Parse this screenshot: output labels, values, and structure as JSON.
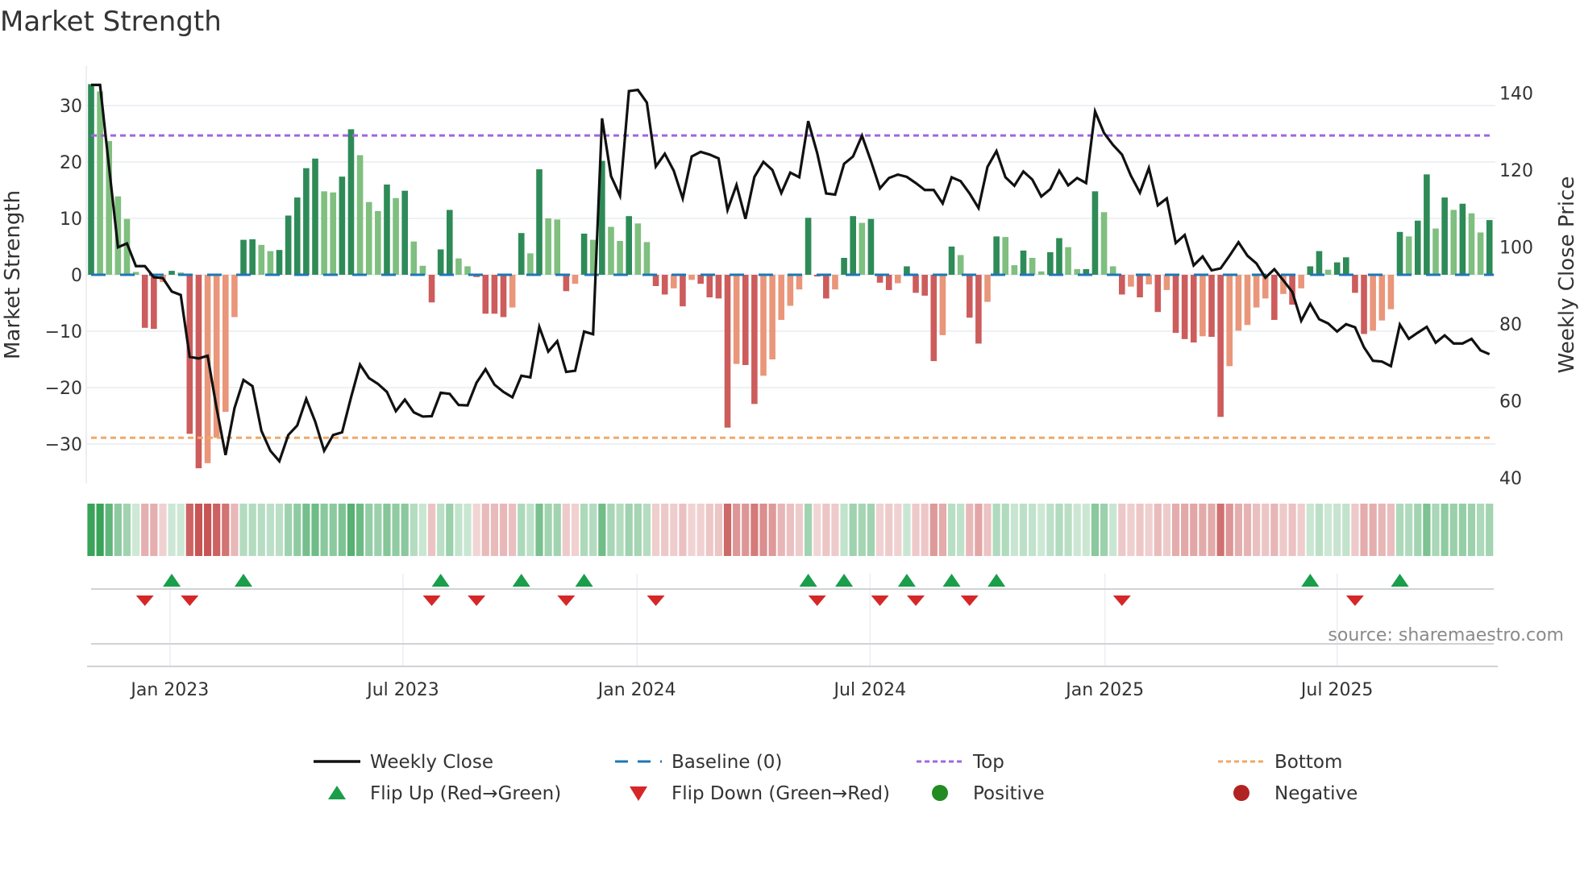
{
  "chart_data": {
    "type": "bar",
    "title": "Market Strength",
    "ylabel": "Market Strength",
    "y2label": "Weekly Close Price",
    "ylim": [
      -37,
      37
    ],
    "y2lim": [
      38.5,
      147
    ],
    "yticks": [
      -30,
      -20,
      -10,
      0,
      10,
      20,
      30
    ],
    "y2ticks": [
      40,
      60,
      80,
      100,
      120,
      140
    ],
    "top_level": 24.7,
    "bottom_level": -28.9,
    "grid": true,
    "legend_placement": "bottom",
    "xticks": [
      {
        "label": "Jan 2023",
        "week_index": 8.8
      },
      {
        "label": "Jul 2023",
        "week_index": 34.8
      },
      {
        "label": "Jan 2024",
        "week_index": 60.9
      },
      {
        "label": "Jul 2024",
        "week_index": 86.9
      },
      {
        "label": "Jan 2025",
        "week_index": 113.1
      },
      {
        "label": "Jul 2025",
        "week_index": 139.0
      }
    ],
    "series": [
      {
        "name": "Market Strength",
        "type": "bar",
        "values": [
          33.8,
          32.5,
          23.7,
          13.9,
          9.9,
          0.5,
          -9.4,
          -9.6,
          -1.3,
          0.7,
          0.4,
          -28.2,
          -34.3,
          -33.4,
          -28.9,
          -24.3,
          -7.5,
          6.2,
          6.3,
          5.3,
          4.2,
          4.4,
          10.5,
          13.7,
          18.9,
          20.6,
          14.8,
          14.6,
          17.4,
          25.8,
          21.2,
          12.9,
          11.3,
          16,
          13.6,
          14.9,
          5.9,
          1.6,
          -4.9,
          4.5,
          11.5,
          2.9,
          1.5,
          -0.4,
          -6.9,
          -6.9,
          -7.5,
          -5.8,
          7.4,
          3.8,
          18.7,
          10,
          9.8,
          -2.9,
          -1.6,
          7.3,
          6.2,
          20.2,
          8.5,
          6,
          10.4,
          9.1,
          5.8,
          -2,
          -3.5,
          -2.4,
          -5.6,
          -0.9,
          -1.6,
          -4,
          -4.2,
          -27.1,
          -15.8,
          -16,
          -22.9,
          -17.9,
          -15,
          -8,
          -5.5,
          -2.6,
          10.1,
          -0.3,
          -4.2,
          -2.6,
          3,
          10.4,
          9.2,
          9.9,
          -1.4,
          -2.7,
          -1.5,
          1.5,
          -3.2,
          -3.7,
          -15.3,
          -10.7,
          5,
          3.5,
          -7.6,
          -12.2,
          -4.8,
          6.8,
          6.7,
          1.7,
          4.3,
          3,
          0.6,
          4,
          6.5,
          4.9,
          1,
          1,
          14.8,
          11.1,
          1.5,
          -3.5,
          -2.1,
          -4,
          -1.7,
          -6.6,
          -2.7,
          -10.3,
          -11.4,
          -12,
          -10.9,
          -11,
          -25.2,
          -16.2,
          -9.9,
          -8.9,
          -5.8,
          -4.2,
          -8,
          -3.4,
          -5.3,
          -2.4,
          1.5,
          4.2,
          0.9,
          2.2,
          3.1,
          -3.2,
          -10.5,
          -9.9,
          -8.1,
          -6.1,
          7.6,
          6.8,
          9.6,
          17.8,
          8.2,
          13.7,
          11.5,
          12.6,
          10.9,
          7.5,
          9.7
        ]
      },
      {
        "name": "Weekly Close",
        "type": "line",
        "axis": "right",
        "values": [
          142.1,
          142.1,
          120.8,
          99.9,
          100.9,
          95.0,
          95.0,
          92.1,
          91.9,
          88.4,
          87.5,
          71.4,
          71.0,
          71.7,
          58.1,
          45.9,
          58.1,
          65.4,
          63.8,
          52.2,
          47.0,
          44.3,
          51.1,
          53.6,
          60.5,
          54.6,
          47.0,
          51.1,
          51.8,
          60.9,
          69.4,
          65.9,
          64.4,
          62.3,
          57.3,
          60.3,
          57.0,
          55.9,
          56.0,
          62.1,
          61.8,
          58.9,
          58.8,
          64.7,
          68.2,
          64.2,
          62.3,
          60.9,
          66.5,
          66.1,
          79.2,
          72.8,
          75.5,
          67.5,
          67.8,
          78.0,
          77.3,
          133.4,
          118.4,
          113.3,
          140.5,
          140.8,
          137.5,
          120.9,
          124.2,
          119.8,
          112.6,
          123.5,
          124.7,
          124.0,
          123.0,
          109.6,
          116.1,
          107.3,
          118.2,
          122.1,
          120.0,
          114.0,
          119.3,
          118.1,
          132.7,
          124.4,
          113.9,
          113.6,
          121.6,
          123.5,
          128.9,
          122.3,
          115.2,
          117.9,
          118.8,
          118.2,
          116.6,
          114.8,
          114.8,
          111.3,
          118.1,
          117.1,
          113.9,
          110.1,
          120.8,
          124.9,
          118.1,
          115.9,
          119.6,
          117.5,
          113.1,
          115.0,
          119.8,
          116.0,
          117.9,
          116.6,
          135.2,
          129.6,
          126.5,
          124.0,
          118.5,
          114.1,
          120.5,
          110.8,
          112.6,
          101.0,
          103.1,
          95.2,
          97.5,
          93.9,
          94.4,
          97.7,
          101.2,
          97.7,
          95.7,
          92.0,
          94.2,
          91.3,
          88.3,
          80.8,
          85.2,
          81.2,
          80.1,
          78.0,
          79.9,
          79.1,
          73.9,
          70.4,
          70.2,
          69.0,
          79.8,
          76.1,
          77.7,
          79.2,
          75.1,
          77.0,
          74.9,
          74.9,
          76.1,
          73.1,
          72.1
        ]
      }
    ],
    "legend": [
      {
        "label": "Weekly Close",
        "marker": "line",
        "color": "#111111"
      },
      {
        "label": "Baseline (0)",
        "marker": "dashed-line",
        "color": "#1f77b4"
      },
      {
        "label": "Top",
        "marker": "dotted-line",
        "color": "#a066e0"
      },
      {
        "label": "Bottom",
        "marker": "dotted-line",
        "color": "#f0a868"
      },
      {
        "label": "Flip Up (Red→Green)",
        "marker": "triangle-up",
        "color": "#1a9e4a"
      },
      {
        "label": "Flip Down (Green→Red)",
        "marker": "triangle-down",
        "color": "#d62728"
      },
      {
        "label": "Positive",
        "marker": "circle",
        "color": "#228b22"
      },
      {
        "label": "Negative",
        "marker": "circle",
        "color": "#b22222"
      }
    ],
    "source": "source: sharemaestro.com",
    "colors": {
      "pos_strong": "#2e8b57",
      "pos_weak": "#7fbf7f",
      "neg_strong": "#cd5c5c",
      "neg_weak": "#e9967a"
    }
  }
}
